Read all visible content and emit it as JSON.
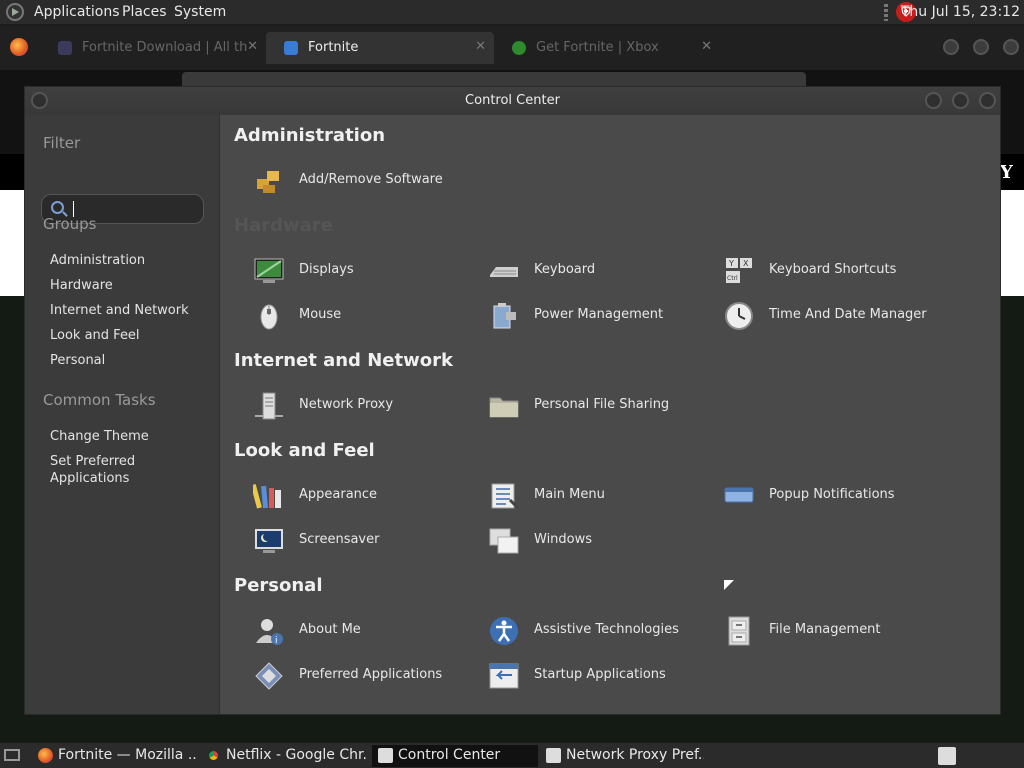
{
  "top_panel": {
    "menus": [
      "Applications",
      "Places",
      "System"
    ],
    "clock": "Thu Jul 15, 23:12"
  },
  "browser": {
    "tabs": [
      {
        "label": "Fortnite Download | All th",
        "state": "inactive"
      },
      {
        "label": "Fortnite",
        "state": "active"
      },
      {
        "label": "Get Fortnite | Xbox",
        "state": "inactive"
      }
    ]
  },
  "window": {
    "title": "Control Center"
  },
  "sidebar": {
    "filter_heading": "Filter",
    "filter_value": "",
    "groups_heading": "Groups",
    "groups": [
      "Administration",
      "Hardware",
      "Internet and Network",
      "Look and Feel",
      "Personal"
    ],
    "tasks_heading": "Common Tasks",
    "tasks": [
      "Change Theme",
      "Set Preferred Applications"
    ]
  },
  "categories": [
    {
      "title": "Administration",
      "items": [
        {
          "label": "Add/Remove Software",
          "icon": "software-package-icon"
        }
      ]
    },
    {
      "title": "Hardware",
      "items": [
        {
          "label": "Displays",
          "icon": "display-icon"
        },
        {
          "label": "Keyboard",
          "icon": "keyboard-icon"
        },
        {
          "label": "Keyboard Shortcuts",
          "icon": "keyboard-shortcuts-icon"
        },
        {
          "label": "Mouse",
          "icon": "mouse-icon"
        },
        {
          "label": "Power Management",
          "icon": "power-management-icon"
        },
        {
          "label": "Time And Date Manager",
          "icon": "clock-icon"
        }
      ]
    },
    {
      "title": "Internet and Network",
      "items": [
        {
          "label": "Network Proxy",
          "icon": "network-proxy-icon"
        },
        {
          "label": "Personal File Sharing",
          "icon": "folder-share-icon"
        }
      ]
    },
    {
      "title": "Look and Feel",
      "items": [
        {
          "label": "Appearance",
          "icon": "appearance-icon"
        },
        {
          "label": "Main Menu",
          "icon": "main-menu-icon"
        },
        {
          "label": "Popup Notifications",
          "icon": "notification-icon"
        },
        {
          "label": "Screensaver",
          "icon": "screensaver-icon"
        },
        {
          "label": "Windows",
          "icon": "windows-icon"
        }
      ]
    },
    {
      "title": "Personal",
      "items": [
        {
          "label": "About Me",
          "icon": "about-me-icon"
        },
        {
          "label": "Assistive Technologies",
          "icon": "accessibility-icon"
        },
        {
          "label": "File Management",
          "icon": "file-cabinet-icon"
        },
        {
          "label": "Preferred Applications",
          "icon": "preferred-apps-icon"
        },
        {
          "label": "Startup Applications",
          "icon": "startup-apps-icon"
        }
      ]
    }
  ],
  "taskbar": {
    "tasks": [
      {
        "label": "Fortnite — Mozilla ...",
        "icon": "firefox-icon"
      },
      {
        "label": "Netflix - Google Chr...",
        "icon": "chrome-icon"
      },
      {
        "label": "Control Center",
        "icon": "control-center-icon"
      },
      {
        "label": "Network Proxy Pref...",
        "icon": "network-proxy-icon"
      }
    ]
  },
  "colors": {
    "window_bg": "#4a4a4a",
    "sidebar_bg": "#3b3b3b",
    "panel_bg": "#2b2b2b",
    "text": "#e8e8e8",
    "muted": "#999999",
    "accent_blue": "#7b9ed8"
  }
}
